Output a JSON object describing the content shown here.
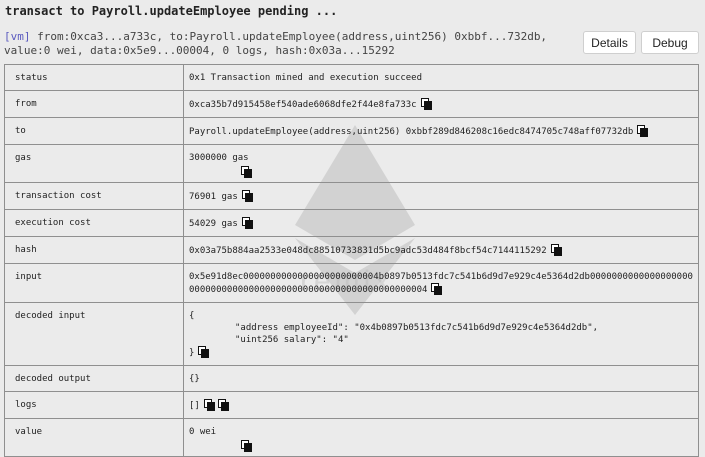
{
  "pending_text": "transact to Payroll.updateEmployee pending ...",
  "summary": {
    "tag": "[vm]",
    "text": " from:0xca3...a733c, to:Payroll.updateEmployee(address,uint256) 0xbbf...732db, value:0 wei, data:0x5e9...00004, 0 logs, hash:0x03a...15292"
  },
  "buttons": {
    "details": "Details",
    "debug": "Debug"
  },
  "rows": {
    "status": {
      "key": "status",
      "value": "0x1 Transaction mined and execution succeed"
    },
    "from": {
      "key": "from",
      "value": "0xca35b7d915458ef540ade6068dfe2f44e8fa733c"
    },
    "to": {
      "key": "to",
      "value": "Payroll.updateEmployee(address,uint256) 0xbbf289d846208c16edc8474705c748aff07732db"
    },
    "gas": {
      "key": "gas",
      "value": "3000000 gas"
    },
    "transaction_cost": {
      "key": "transaction cost",
      "value": "76901 gas"
    },
    "execution_cost": {
      "key": "execution cost",
      "value": "54029 gas"
    },
    "hash": {
      "key": "hash",
      "value": "0x03a75b884aa2533e048dc88510733831d5bc9adc53d484f8bcf54c7144115292"
    },
    "input": {
      "key": "input",
      "value": "0x5e91d8ec0000000000000000000000004b0897b0513fdc7c541b6d9d7e929c4e5364d2db000000000000000000000000000000000000000000000000000000000000004"
    },
    "decoded_input": {
      "key": "decoded input",
      "open": "{",
      "line1": "\"address employeeId\": \"0x4b0897b0513fdc7c541b6d9d7e929c4e5364d2db\",",
      "line2": "\"uint256 salary\": \"4\"",
      "close": "}"
    },
    "decoded_output": {
      "key": "decoded output",
      "value": "{}"
    },
    "logs": {
      "key": "logs",
      "value": "[]"
    },
    "value": {
      "key": "value",
      "value": "0 wei"
    }
  },
  "watermark_text": "remix"
}
